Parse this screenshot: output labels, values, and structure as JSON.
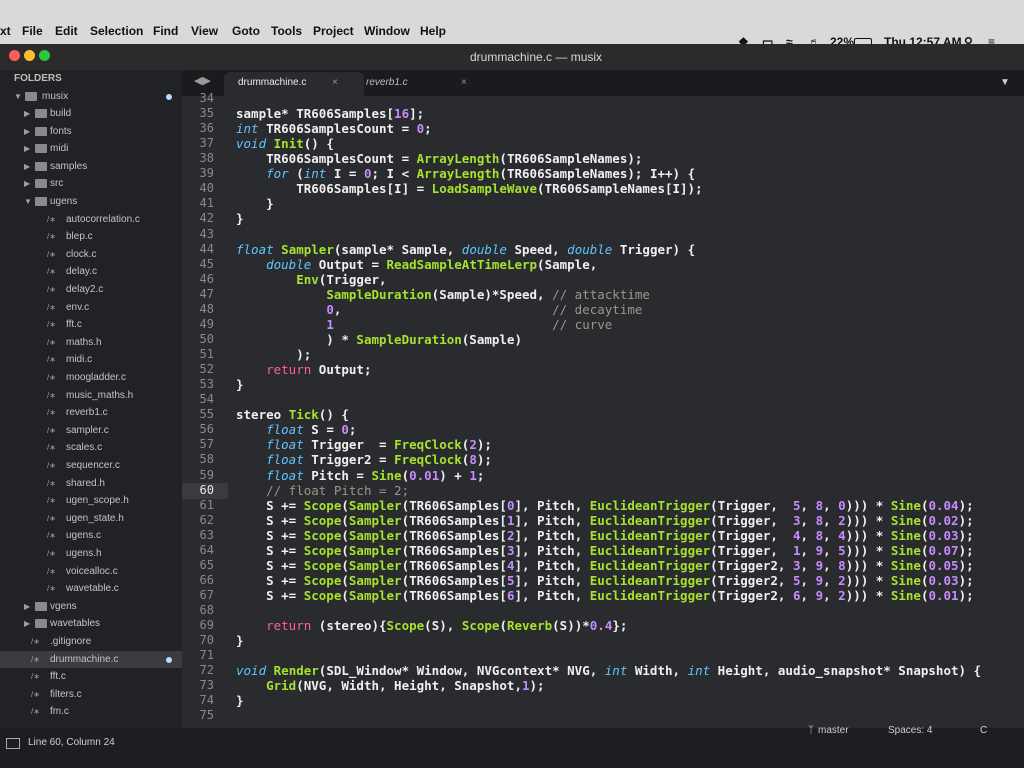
{
  "menubar": {
    "app": "xt",
    "items": [
      "File",
      "Edit",
      "Selection",
      "Find",
      "View",
      "Goto",
      "Tools",
      "Project",
      "Window",
      "Help"
    ],
    "battery": "22%",
    "clock": "Thu 12:57 AM"
  },
  "window": {
    "title": "drummachine.c — musix"
  },
  "sidebar": {
    "heading": "FOLDERS",
    "root": "musix",
    "items": [
      {
        "label": "build",
        "type": "folder",
        "depth": 1
      },
      {
        "label": "fonts",
        "type": "folder",
        "depth": 1
      },
      {
        "label": "midi",
        "type": "folder",
        "depth": 1
      },
      {
        "label": "samples",
        "type": "folder",
        "depth": 1
      },
      {
        "label": "src",
        "type": "folder",
        "depth": 1
      },
      {
        "label": "ugens",
        "type": "folder",
        "depth": 1,
        "open": true
      },
      {
        "label": "autocorrelation.c",
        "type": "file",
        "depth": 2
      },
      {
        "label": "blep.c",
        "type": "file",
        "depth": 2
      },
      {
        "label": "clock.c",
        "type": "file",
        "depth": 2
      },
      {
        "label": "delay.c",
        "type": "file",
        "depth": 2
      },
      {
        "label": "delay2.c",
        "type": "file",
        "depth": 2
      },
      {
        "label": "env.c",
        "type": "file",
        "depth": 2
      },
      {
        "label": "fft.c",
        "type": "file",
        "depth": 2
      },
      {
        "label": "maths.h",
        "type": "file",
        "depth": 2
      },
      {
        "label": "midi.c",
        "type": "file",
        "depth": 2
      },
      {
        "label": "moogladder.c",
        "type": "file",
        "depth": 2
      },
      {
        "label": "music_maths.h",
        "type": "file",
        "depth": 2
      },
      {
        "label": "reverb1.c",
        "type": "file",
        "depth": 2
      },
      {
        "label": "sampler.c",
        "type": "file",
        "depth": 2
      },
      {
        "label": "scales.c",
        "type": "file",
        "depth": 2
      },
      {
        "label": "sequencer.c",
        "type": "file",
        "depth": 2
      },
      {
        "label": "shared.h",
        "type": "file",
        "depth": 2
      },
      {
        "label": "ugen_scope.h",
        "type": "file",
        "depth": 2
      },
      {
        "label": "ugen_state.h",
        "type": "file",
        "depth": 2
      },
      {
        "label": "ugens.c",
        "type": "file",
        "depth": 2
      },
      {
        "label": "ugens.h",
        "type": "file",
        "depth": 2
      },
      {
        "label": "voicealloc.c",
        "type": "file",
        "depth": 2
      },
      {
        "label": "wavetable.c",
        "type": "file",
        "depth": 2
      },
      {
        "label": "vgens",
        "type": "folder",
        "depth": 1
      },
      {
        "label": "wavetables",
        "type": "folder",
        "depth": 1
      },
      {
        "label": ".gitignore",
        "type": "file",
        "depth": 1
      },
      {
        "label": "drummachine.c",
        "type": "file",
        "depth": 1,
        "selected": true
      },
      {
        "label": "fft.c",
        "type": "file",
        "depth": 1
      },
      {
        "label": "filters.c",
        "type": "file",
        "depth": 1
      },
      {
        "label": "fm.c",
        "type": "file",
        "depth": 1
      }
    ]
  },
  "tabs": [
    {
      "label": "drummachine.c",
      "active": true
    },
    {
      "label": "reverb1.c",
      "active": false
    }
  ],
  "editor": {
    "current_line": 60,
    "line_numbers": [
      34,
      35,
      36,
      37,
      38,
      39,
      40,
      41,
      42,
      43,
      44,
      45,
      46,
      47,
      48,
      49,
      50,
      51,
      52,
      53,
      54,
      55,
      56,
      57,
      58,
      59,
      60,
      61,
      62,
      63,
      64,
      65,
      66,
      67,
      68,
      69,
      70,
      71,
      72,
      73,
      74,
      75
    ],
    "lines": [
      "",
      "sample* TR606Samples[16];",
      "int TR606SamplesCount = 0;",
      "void Init() {",
      "    TR606SamplesCount = ArrayLength(TR606SampleNames);",
      "    for (int I = 0; I < ArrayLength(TR606SampleNames); I++) {",
      "        TR606Samples[I] = LoadSampleWave(TR606SampleNames[I]);",
      "    }",
      "}",
      "",
      "float Sampler(sample* Sample, double Speed, double Trigger) {",
      "    double Output = ReadSampleAtTimeLerp(Sample,",
      "        Env(Trigger,",
      "            SampleDuration(Sample)*Speed, // attacktime",
      "            0,                            // decaytime",
      "            1                             // curve",
      "            ) * SampleDuration(Sample)",
      "        );",
      "    return Output;",
      "}",
      "",
      "stereo Tick() {",
      "    float S = 0;",
      "    float Trigger  = FreqClock(2);",
      "    float Trigger2 = FreqClock(8);",
      "    float Pitch = Sine(0.01) + 1;",
      "    // float Pitch = 2;",
      "    S += Scope(Sampler(TR606Samples[0], Pitch, EuclideanTrigger(Trigger,  5, 8, 0))) * Sine(0.04);",
      "    S += Scope(Sampler(TR606Samples[1], Pitch, EuclideanTrigger(Trigger,  3, 8, 2))) * Sine(0.02);",
      "    S += Scope(Sampler(TR606Samples[2], Pitch, EuclideanTrigger(Trigger,  4, 8, 4))) * Sine(0.03);",
      "    S += Scope(Sampler(TR606Samples[3], Pitch, EuclideanTrigger(Trigger,  1, 9, 5))) * Sine(0.07);",
      "    S += Scope(Sampler(TR606Samples[4], Pitch, EuclideanTrigger(Trigger2, 3, 9, 8))) * Sine(0.05);",
      "    S += Scope(Sampler(TR606Samples[5], Pitch, EuclideanTrigger(Trigger2, 5, 9, 2))) * Sine(0.03);",
      "    S += Scope(Sampler(TR606Samples[6], Pitch, EuclideanTrigger(Trigger2, 6, 9, 2))) * Sine(0.01);",
      "",
      "    return (stereo){Scope(S), Scope(Reverb(S))*0.4};",
      "}",
      "",
      "void Render(SDL_Window* Window, NVGcontext* NVG, int Width, int Height, audio_snapshot* Snapshot) {",
      "    Grid(NVG, Width, Height, Snapshot,1);",
      "}",
      ""
    ]
  },
  "statusbar": {
    "position": "Line 60, Column 24",
    "branch": "master",
    "indent": "Spaces: 4",
    "syntax": "C"
  }
}
